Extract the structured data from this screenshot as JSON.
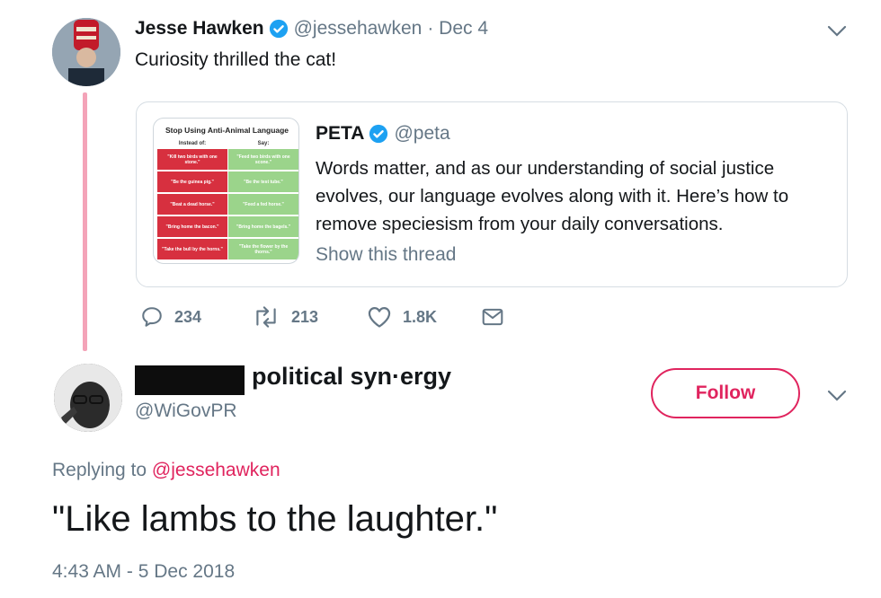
{
  "tweet1": {
    "name": "Jesse Hawken",
    "handle": "@jessehawken",
    "date": "· Dec 4",
    "text": "Curiosity thrilled the cat!"
  },
  "quote": {
    "name": "PETA",
    "handle": "@peta",
    "text": "Words matter, and as our understanding of social justice evolves, our language evolves along with it. Here’s how to remove speciesism from your daily conversations.",
    "show_thread": "Show this thread",
    "image": {
      "title": "Stop Using Anti-Animal Language",
      "col_left_head": "Instead of:",
      "col_right_head": "Say:",
      "left": [
        "\"Kill two birds with one stone.\"",
        "\"Be the guinea pig.\"",
        "\"Beat a dead horse.\"",
        "\"Bring home the bacon.\"",
        "\"Take the bull by the horns.\""
      ],
      "right": [
        "\"Feed two birds with one scone.\"",
        "\"Be the test tube.\"",
        "\"Feed a fed horse.\"",
        "\"Bring home the bagels.\"",
        "\"Take the flower by the thorns.\""
      ]
    }
  },
  "actions": {
    "replies": "234",
    "retweets": "213",
    "likes": "1.8K"
  },
  "tweet2": {
    "name": "political syn·ergy",
    "handle": "@WiGovPR",
    "follow_label": "Follow",
    "replying_prefix": "Replying to",
    "replying_handle": "@jessehawken",
    "text": "\"Like lambs to the laughter.\"",
    "timestamp": "4:43 AM - 5 Dec 2018"
  },
  "colors": {
    "accent": "#e0245e",
    "muted": "#657786",
    "verified": "#1da1f2",
    "thread_line": "#f4a3b8"
  }
}
